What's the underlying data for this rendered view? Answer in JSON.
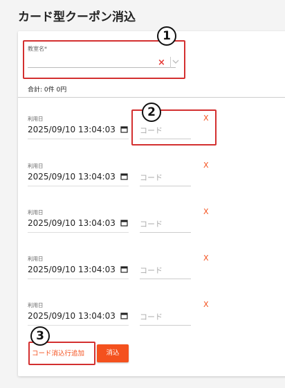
{
  "page": {
    "title": "カード型クーポン消込"
  },
  "school": {
    "label": "教室名*",
    "value": "",
    "clear": "×"
  },
  "summary": {
    "total": "合計: 0件 0円"
  },
  "rows": [
    {
      "label": "利用日",
      "datetime": "2025/09/10  13:04:03",
      "code_placeholder": "コード",
      "remove": "X"
    },
    {
      "label": "利用日",
      "datetime": "2025/09/10  13:04:03",
      "code_placeholder": "コード",
      "remove": "X"
    },
    {
      "label": "利用日",
      "datetime": "2025/09/10  13:04:03",
      "code_placeholder": "コード",
      "remove": "X"
    },
    {
      "label": "利用日",
      "datetime": "2025/09/10  13:04:03",
      "code_placeholder": "コード",
      "remove": "X"
    },
    {
      "label": "利用日",
      "datetime": "2025/09/10  13:04:03",
      "code_placeholder": "コード",
      "remove": "X"
    }
  ],
  "actions": {
    "add_row": "コード消込行追加",
    "consume": "消込"
  },
  "annotations": {
    "one": "1",
    "two": "2",
    "three": "3",
    "color": "#d32f2f"
  },
  "colors": {
    "accent": "#f4511e",
    "error": "#e53935"
  }
}
